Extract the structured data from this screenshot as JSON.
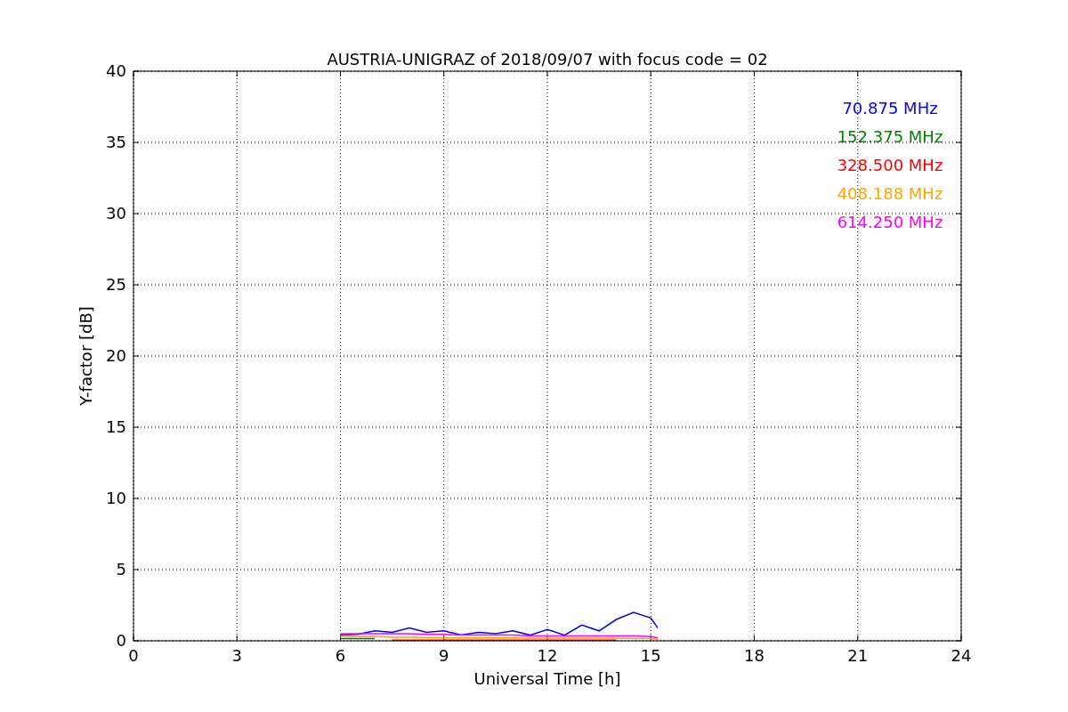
{
  "chart_data": {
    "type": "line",
    "title": "AUSTRIA-UNIGRAZ of 2018/09/07 with focus code = 02",
    "xlabel": "Universal Time [h]",
    "ylabel": "Y-factor [dB]",
    "x": [
      6,
      6.5,
      7,
      7.5,
      8,
      8.5,
      9,
      9.5,
      10,
      10.5,
      11,
      11.5,
      12,
      12.5,
      13,
      13.5,
      14,
      14.5,
      15,
      15.2
    ],
    "series": [
      {
        "name": "70.875 MHz",
        "color": "#0000ff",
        "values": [
          0.4,
          0.45,
          0.7,
          0.6,
          0.9,
          0.6,
          0.7,
          0.4,
          0.6,
          0.5,
          0.7,
          0.4,
          0.8,
          0.4,
          1.1,
          0.7,
          1.5,
          2.0,
          1.6,
          0.9
        ]
      },
      {
        "name": "152.375 MHz",
        "color": "#008000",
        "values": [
          0.15,
          0.15,
          0.15,
          null,
          null,
          null,
          null,
          null,
          null,
          null,
          null,
          null,
          null,
          null,
          null,
          null,
          null,
          null,
          null,
          null
        ]
      },
      {
        "name": "328.500 MHz",
        "color": "#ff0000",
        "values": [
          null,
          null,
          null,
          0.05,
          0.05,
          0.05,
          0.05,
          0.05,
          0.05,
          0.05,
          0.05,
          0.05,
          0.05,
          0.05,
          0.05,
          0.05,
          0.05,
          null,
          null,
          null
        ]
      },
      {
        "name": "408.188 MHz",
        "color": "#ffa500",
        "values": [
          0.3,
          0.3,
          0.3,
          0.25,
          0.25,
          0.22,
          0.22,
          0.2,
          0.2,
          0.2,
          0.2,
          0.18,
          0.18,
          0.18,
          0.18,
          0.18,
          0.18,
          0.15,
          0.15,
          0.1
        ]
      },
      {
        "name": "614.250 MHz",
        "color": "#ff00ff",
        "values": [
          0.5,
          0.5,
          0.5,
          0.5,
          0.5,
          0.45,
          0.45,
          0.4,
          0.4,
          0.4,
          0.4,
          0.35,
          0.35,
          0.35,
          0.35,
          0.35,
          0.35,
          0.35,
          0.3,
          0.2
        ]
      }
    ],
    "grid": true,
    "xlim": [
      0,
      24
    ],
    "ylim": [
      0,
      40
    ],
    "xticks": [
      0,
      3,
      6,
      9,
      12,
      15,
      18,
      21,
      24
    ],
    "yticks": [
      0,
      5,
      10,
      15,
      20,
      25,
      30,
      35,
      40
    ]
  }
}
